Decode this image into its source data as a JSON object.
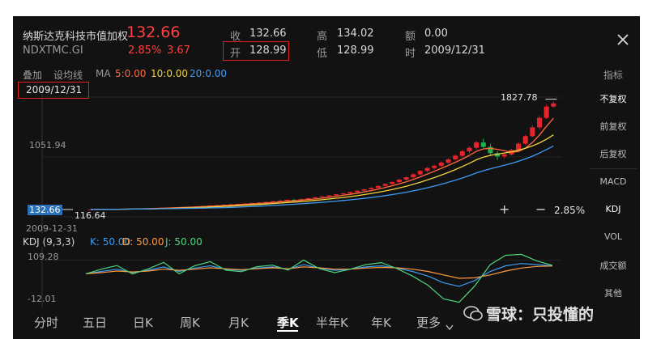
{
  "header": {
    "name": "纳斯达克科技市值加权",
    "price": "132.66",
    "code": "NDXTMC.GI",
    "change_pct": "2.85%",
    "change_abs": "3.67",
    "close_label": "收",
    "close_value": "132.66",
    "open_label": "开",
    "open_value": "128.99",
    "high_label": "高",
    "high_value": "134.02",
    "low_label": "低",
    "low_value": "128.99",
    "amount_label": "额",
    "amount_value": "0.00",
    "time_label": "时",
    "time_value": "2009/12/31"
  },
  "toolbar": {
    "overlay": "叠加",
    "draw": "设均线",
    "ma_label": "MA",
    "ma5": "5:0.00",
    "ma10": "10:0.00",
    "ma20": "20:0.00",
    "indicator": "指标"
  },
  "chart": {
    "date_box": "2009/12/31",
    "high_label": "1827.78",
    "mid_label": "1051.94",
    "price_tag": "132.66",
    "low_label": "116.64",
    "bottom_date": "2009-12-31",
    "change_right": "2.85%",
    "plus": "+",
    "minus": "−"
  },
  "kdj": {
    "title": "KDJ (9,3,3)",
    "k": "K: 50.00",
    "d": "D: 50.00",
    "j": "J: 50.00",
    "top": "109.28",
    "bottom": "-12.01"
  },
  "sidebar": [
    "不复权",
    "前复权",
    "后复权",
    "MACD",
    "KDJ",
    "VOL",
    "成交额",
    "其他"
  ],
  "periods": [
    "分时",
    "五日",
    "日K",
    "周K",
    "月K",
    "季K",
    "半年K",
    "年K",
    "更多"
  ],
  "watermark": "雪球：只投懂的",
  "colors": {
    "up": "#e8232a",
    "down": "#21b24b",
    "ma5": "#ff6b3d",
    "ma10": "#f2d43a",
    "ma20": "#3d9cf2"
  },
  "chart_data": {
    "type": "candlestick",
    "ylim": [
      0,
      1900
    ],
    "ohlc": [
      [
        116.64,
        118,
        115,
        117
      ],
      [
        117,
        120,
        116,
        119
      ],
      [
        119,
        121,
        118,
        120
      ],
      [
        120,
        123,
        119,
        122
      ],
      [
        122,
        126,
        121,
        124
      ],
      [
        124,
        128,
        123,
        127
      ],
      [
        127,
        131,
        126,
        130
      ],
      [
        130,
        134,
        128,
        133
      ],
      [
        133,
        138,
        131,
        136
      ],
      [
        136,
        140,
        134,
        139
      ],
      [
        139,
        144,
        137,
        143
      ],
      [
        143,
        148,
        141,
        147
      ],
      [
        147,
        152,
        145,
        151
      ],
      [
        151,
        158,
        149,
        156
      ],
      [
        156,
        163,
        154,
        161
      ],
      [
        161,
        168,
        159,
        167
      ],
      [
        167,
        175,
        165,
        173
      ],
      [
        173,
        182,
        171,
        180
      ],
      [
        180,
        189,
        178,
        186
      ],
      [
        186,
        195,
        184,
        193
      ],
      [
        193,
        202,
        190,
        199
      ],
      [
        199,
        208,
        196,
        205
      ],
      [
        205,
        214,
        202,
        212
      ],
      [
        212,
        222,
        209,
        219
      ],
      [
        219,
        230,
        216,
        227
      ],
      [
        227,
        240,
        224,
        236
      ],
      [
        236,
        250,
        233,
        247
      ],
      [
        247,
        262,
        243,
        258
      ],
      [
        258,
        274,
        255,
        270
      ],
      [
        270,
        285,
        265,
        262
      ],
      [
        262,
        290,
        258,
        282
      ],
      [
        282,
        300,
        278,
        296
      ],
      [
        296,
        315,
        292,
        310
      ],
      [
        310,
        330,
        305,
        325
      ],
      [
        325,
        345,
        320,
        340
      ],
      [
        340,
        362,
        335,
        358
      ],
      [
        358,
        380,
        352,
        372
      ],
      [
        372,
        398,
        366,
        392
      ],
      [
        392,
        420,
        386,
        415
      ],
      [
        415,
        445,
        408,
        438
      ],
      [
        438,
        470,
        430,
        460
      ],
      [
        460,
        498,
        452,
        490
      ],
      [
        490,
        530,
        480,
        522
      ],
      [
        522,
        560,
        512,
        552
      ],
      [
        552,
        600,
        540,
        590
      ],
      [
        590,
        640,
        575,
        628
      ],
      [
        628,
        690,
        610,
        675
      ],
      [
        675,
        740,
        660,
        728
      ],
      [
        728,
        790,
        710,
        775
      ],
      [
        775,
        830,
        750,
        810
      ],
      [
        810,
        880,
        790,
        860
      ],
      [
        860,
        930,
        840,
        912
      ],
      [
        912,
        990,
        895,
        970
      ],
      [
        970,
        1060,
        950,
        1040
      ],
      [
        1040,
        1120,
        1010,
        1095
      ],
      [
        1095,
        1200,
        1070,
        1180
      ],
      [
        1180,
        1240,
        1090,
        1110
      ],
      [
        1110,
        1160,
        980,
        1010
      ],
      [
        1010,
        1040,
        900,
        960
      ],
      [
        960,
        1010,
        930,
        990
      ],
      [
        990,
        1080,
        975,
        1060
      ],
      [
        1060,
        1180,
        1040,
        1160
      ],
      [
        1160,
        1300,
        1140,
        1280
      ],
      [
        1280,
        1450,
        1260,
        1420
      ],
      [
        1420,
        1600,
        1390,
        1570
      ],
      [
        1570,
        1780,
        1550,
        1750
      ],
      [
        1750,
        1827.78,
        1730,
        1800
      ]
    ],
    "kdj_k": [
      50,
      60,
      70,
      55,
      65,
      80,
      60,
      75,
      85,
      70,
      65,
      75,
      80,
      70,
      90,
      75,
      65,
      70,
      80,
      85,
      75,
      60,
      40,
      10,
      -5,
      20,
      60,
      85,
      95,
      90,
      85
    ],
    "kdj_d": [
      50,
      55,
      62,
      58,
      62,
      70,
      65,
      70,
      76,
      72,
      68,
      72,
      76,
      72,
      80,
      76,
      70,
      70,
      75,
      78,
      76,
      70,
      60,
      45,
      30,
      32,
      45,
      62,
      75,
      82,
      84
    ],
    "kdj_j": [
      50,
      70,
      86,
      49,
      71,
      100,
      50,
      85,
      103,
      66,
      59,
      81,
      88,
      66,
      110,
      73,
      55,
      70,
      90,
      99,
      73,
      40,
      0,
      -60,
      -75,
      -4,
      90,
      131,
      135,
      106,
      87
    ]
  }
}
